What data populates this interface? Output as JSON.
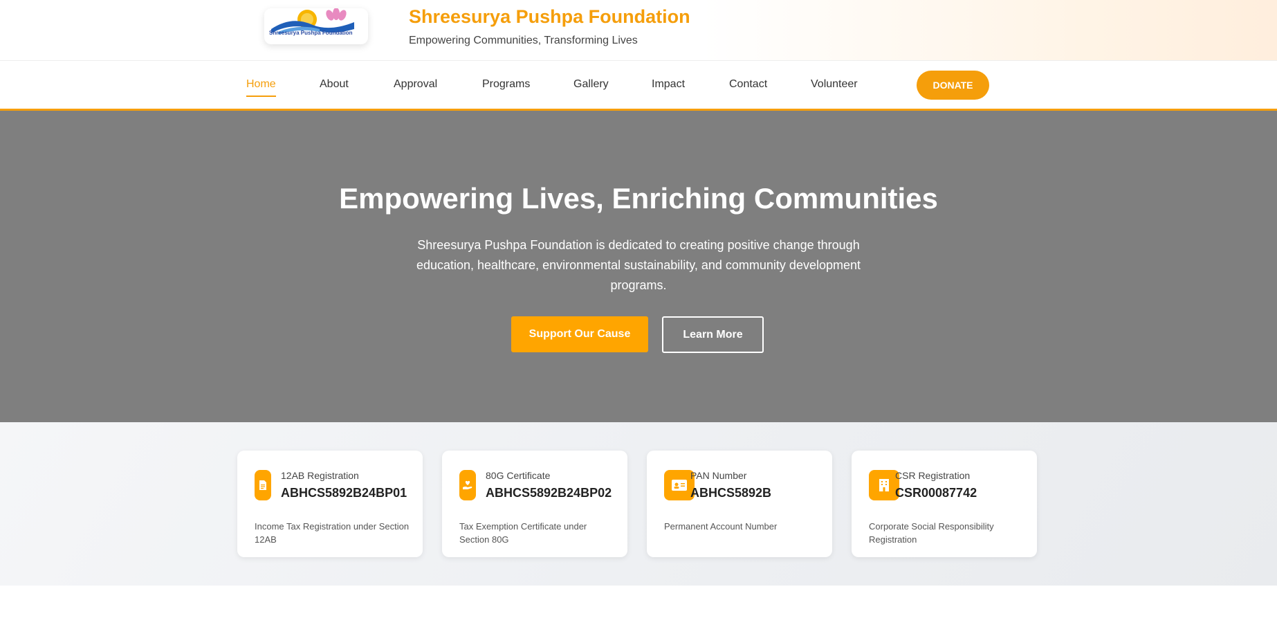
{
  "header": {
    "logo_text": "Shreesurya Pushpa  Foundation",
    "title": "Shreesurya Pushpa Foundation",
    "subtitle": "Empowering Communities, Transforming Lives"
  },
  "nav": {
    "items": [
      {
        "label": "Home",
        "active": true
      },
      {
        "label": "About"
      },
      {
        "label": "Approval"
      },
      {
        "label": "Programs"
      },
      {
        "label": "Gallery"
      },
      {
        "label": "Impact"
      },
      {
        "label": "Contact"
      },
      {
        "label": "Volunteer"
      }
    ],
    "donate_label": "DONATE"
  },
  "hero": {
    "title": "Empowering Lives, Enriching Communities",
    "description": "Shreesurya Pushpa Foundation is dedicated to creating positive change through education, healthcare, environmental sustainability, and community development programs.",
    "primary_button": "Support Our Cause",
    "secondary_button": "Learn More"
  },
  "registrations": [
    {
      "icon": "document-icon",
      "label": "12AB Registration",
      "value": "ABHCS5892B24BP01",
      "description": "Income Tax Registration under Section 12AB"
    },
    {
      "icon": "hand-heart-icon",
      "label": "80G Certificate",
      "value": "ABHCS5892B24BP02",
      "description": "Tax Exemption Certificate under Section 80G"
    },
    {
      "icon": "id-card-icon",
      "label": "PAN Number",
      "value": "ABHCS5892B",
      "description": "Permanent Account Number"
    },
    {
      "icon": "building-icon",
      "label": "CSR Registration",
      "value": "CSR00087742",
      "description": "Corporate Social Responsibility Registration"
    }
  ],
  "colors": {
    "accent": "#f59e0b",
    "hero_bg": "#7f7f7f",
    "button_primary": "#ffa500"
  }
}
